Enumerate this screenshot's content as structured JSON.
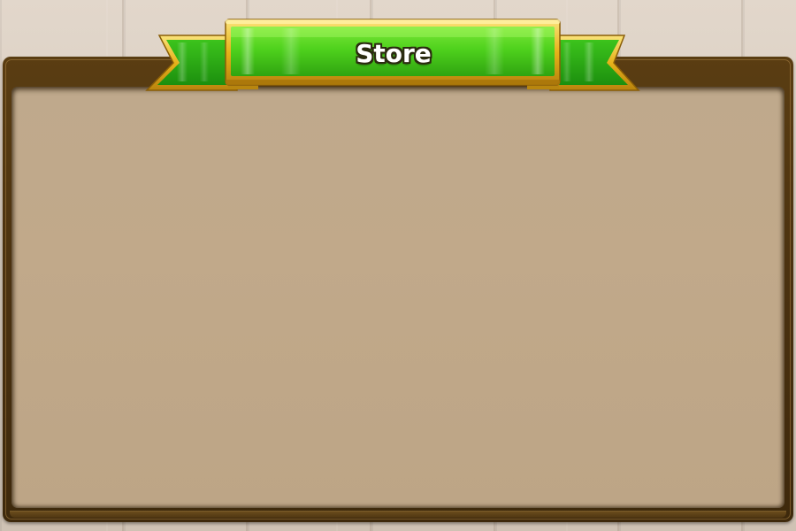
{
  "store_panel": {
    "title": "Store",
    "items": []
  },
  "theme": {
    "ribbon_green": "#3fc61a",
    "ribbon_gold": "#e8b51c",
    "frame_brown": "#4a3110",
    "panel_fill": "#c0a888"
  }
}
